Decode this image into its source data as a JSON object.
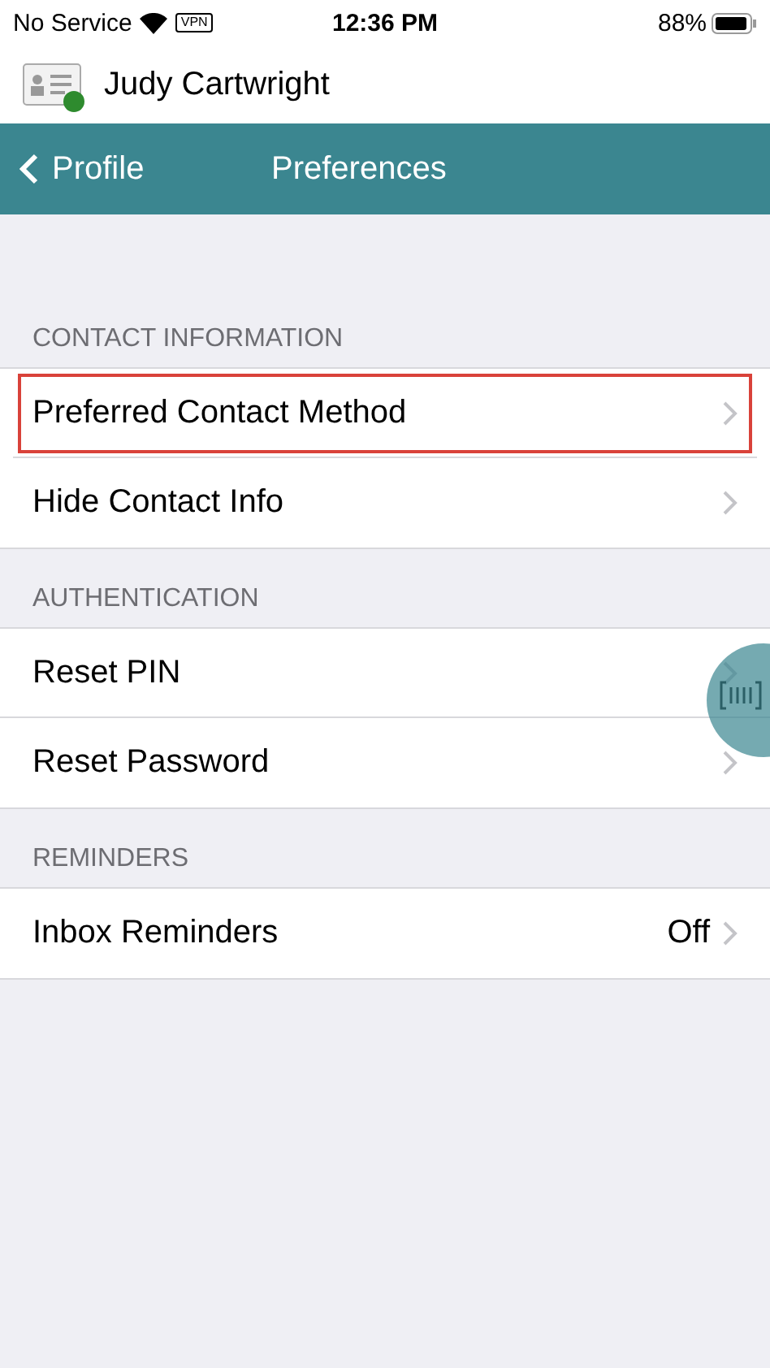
{
  "status_bar": {
    "carrier": "No Service",
    "vpn": "VPN",
    "time": "12:36 PM",
    "battery": "88%"
  },
  "user": {
    "name": "Judy Cartwright",
    "online": true
  },
  "nav": {
    "back": "Profile",
    "title": "Preferences"
  },
  "sections": [
    {
      "title": "CONTACT INFORMATION",
      "rows": [
        {
          "label": "Preferred Contact Method",
          "selected": true
        },
        {
          "label": "Hide Contact Info",
          "selected": false
        }
      ]
    },
    {
      "title": "AUTHENTICATION",
      "rows": [
        {
          "label": "Reset PIN",
          "selected": false
        },
        {
          "label": "Reset Password",
          "selected": false
        }
      ]
    },
    {
      "title": "REMINDERS",
      "rows": [
        {
          "label": "Inbox Reminders",
          "value": "Off",
          "selected": false
        }
      ]
    }
  ]
}
